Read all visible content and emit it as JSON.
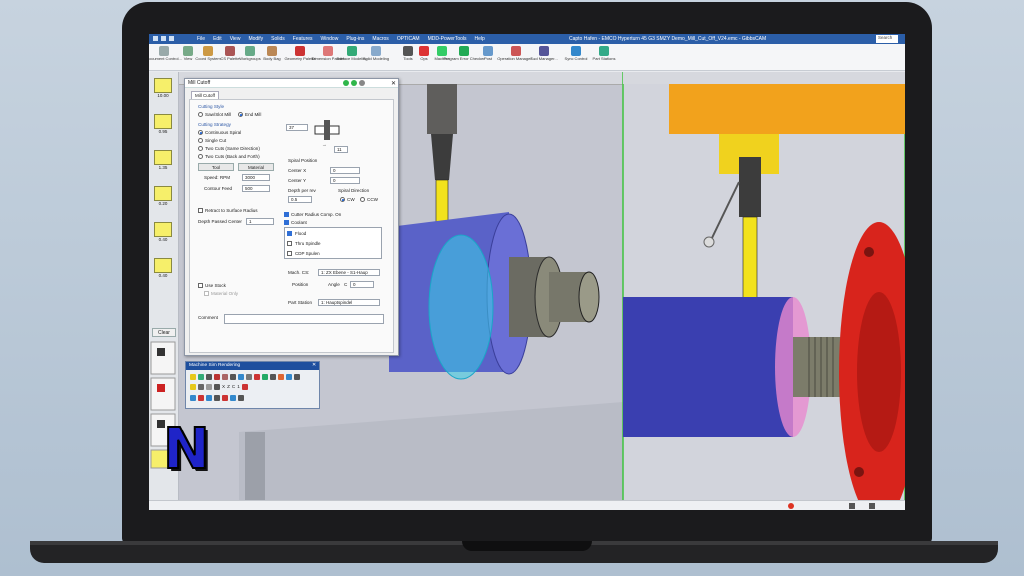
{
  "window": {
    "title": "Capto Hafen - EMCO Hyperturn 45 G3 SMZY Demo_Mill_Cut_Off_V24.emc - GibbsCAM",
    "search_placeholder": "Search"
  },
  "menu": [
    "File",
    "Edit",
    "View",
    "Modify",
    "Solids",
    "Features",
    "Window",
    "Plug-ins",
    "Macros",
    "OPTICAM",
    "MDD-PowerTools",
    "Help"
  ],
  "ribbon": [
    {
      "label": "Document Control...",
      "icon": "document-control-icon"
    },
    {
      "label": "View",
      "icon": "view-icon"
    },
    {
      "label": "Coord System",
      "icon": "coord-system-icon"
    },
    {
      "label": "CS Palette",
      "icon": "cs-palette-icon"
    },
    {
      "label": "Workgroups",
      "icon": "workgroups-icon"
    },
    {
      "label": "Body Bag",
      "icon": "body-bag-icon"
    },
    {
      "label": "Geometry Palette",
      "icon": "geometry-palette-icon"
    },
    {
      "label": "Dimension Palette",
      "icon": "dimension-palette-icon"
    },
    {
      "label": "Surface Modeling",
      "icon": "surface-modeling-icon"
    },
    {
      "label": "Solid Modeling",
      "icon": "solid-modeling-icon"
    },
    {
      "label": "Tools",
      "icon": "tools-icon"
    },
    {
      "label": "Ops",
      "icon": "ops-icon"
    },
    {
      "label": "Machine",
      "icon": "machine-icon"
    },
    {
      "label": "Program Error Checker",
      "icon": "program-error-checker-icon"
    },
    {
      "label": "Post",
      "icon": "post-icon"
    },
    {
      "label": "Operation Manager...",
      "icon": "operation-manager-icon"
    },
    {
      "label": "Tool Manager...",
      "icon": "tool-manager-icon"
    },
    {
      "label": "Sync Control",
      "icon": "sync-control-icon"
    },
    {
      "label": "Part Stations",
      "icon": "part-stations-icon"
    }
  ],
  "toolbar_left": {
    "values": [
      "10.00",
      "0.95",
      "1.35",
      "0.20",
      "0.40",
      "0.40"
    ],
    "clear": "Clear"
  },
  "dialog": {
    "title": "Mill Cutoff",
    "tab": "Mill Cutoff",
    "cutting_style_label": "Cutting Style",
    "cutting_styles": [
      "Saw/Slot Mill",
      "End Mill"
    ],
    "selected_style": "End Mill",
    "cutting_strategy_label": "Cutting Strategy",
    "strategies": [
      "Continuous Spiral",
      "Single Cut",
      "Two Cuts (Same Direction)",
      "Two Cuts (Back and Forth)"
    ],
    "selected_strategy": "Continuous Spiral",
    "dim1": "37",
    "dim2": "11",
    "tool_btn": "Tool",
    "material_btn": "Material",
    "speed_label": "Speed: RPM",
    "speed_value": "3000",
    "feed_label": "Contour Feed",
    "feed_value": "500",
    "spiral_pos_label": "Spiral Position",
    "center_x_label": "Center X",
    "center_x": "0",
    "center_y_label": "Center Y",
    "center_y": "0",
    "depth_rev_label": "Depth per rev",
    "depth_rev": "0.5",
    "spiral_dir_label": "Spiral Direction",
    "cw": "CW",
    "ccw": "CCW",
    "retract_label": "Retract to Surface Radius",
    "depth_passed_label": "Depth Passed Center",
    "depth_passed": "1",
    "cutter_comp_label": "Cutter Radius Comp. On",
    "coolant_label": "Coolant",
    "coolant_items": [
      "Flood",
      "Thru Spindle",
      "CDP Spulen"
    ],
    "use_stock_label": "Use Stock",
    "material_only_label": "Material Only",
    "mach_cs_label": "Mach. CS:",
    "mach_cs": "1: ZX Ebene - S1-Haup",
    "position_label": "Position",
    "angle_label": "Angle",
    "c_label": "C",
    "angle_value": "0",
    "part_station_label": "Part Station",
    "part_station": "1: Hauptspindel",
    "comment_label": "Comment"
  },
  "palette": {
    "title": "Machine Sim Rendering",
    "nums": [
      "X",
      "Z",
      "C",
      "1"
    ]
  },
  "brand_letter": "N",
  "colors": {
    "accent": "#2b5ea8",
    "tool_yellow": "#f2e21c",
    "flange_red": "#d8241c",
    "stock_blue": "#3a3fb0"
  }
}
